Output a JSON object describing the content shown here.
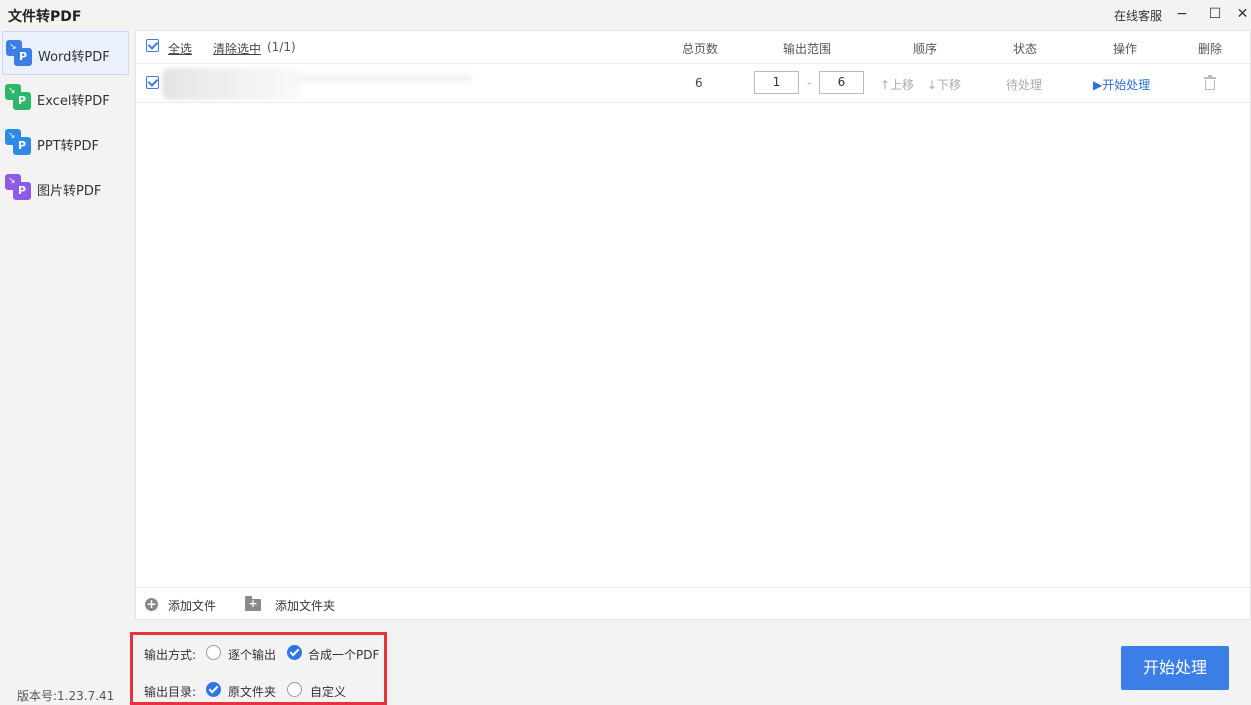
{
  "window": {
    "title": "文件转PDF",
    "service": "在线客服",
    "min_icon": "−",
    "max_icon": "☐",
    "close_icon": "✕"
  },
  "sidebar": {
    "items": [
      {
        "label": "Word转PDF",
        "color": "#3b7fe6",
        "active": true
      },
      {
        "label": "Excel转PDF",
        "color": "#2eb66a"
      },
      {
        "label": "PPT转PDF",
        "color": "#2e8ae6"
      },
      {
        "label": "图片转PDF",
        "color": "#8c5be8"
      }
    ]
  },
  "table": {
    "select_all": "全选",
    "clear_selection": "清除选中",
    "count": "(1/1)",
    "columns": {
      "pages": "总页数",
      "range": "输出范围",
      "order": "顺序",
      "status": "状态",
      "action": "操作",
      "delete": "删除"
    },
    "rows": [
      {
        "pages": "6",
        "range_from": "1",
        "range_sep": "-",
        "range_to": "6",
        "move_up": "↑上移",
        "move_down": "↓下移",
        "status": "待处理",
        "action": "▶开始处理"
      }
    ]
  },
  "bottom": {
    "add_file_icon": "+",
    "add_file": "添加文件",
    "add_folder_icon": "+",
    "add_folder": "添加文件夹"
  },
  "options": {
    "output_mode_label": "输出方式:",
    "output_mode_options": [
      "逐个输出",
      "合成一个PDF"
    ],
    "output_mode_selected": "合成一个PDF",
    "output_dir_label": "输出目录:",
    "output_dir_options": [
      "原文件夹",
      "自定义"
    ],
    "output_dir_selected": "原文件夹"
  },
  "footer": {
    "version": "版本号:1.23.7.41",
    "start_button": "开始处理"
  },
  "colors": {
    "accent": "#3a7ee6",
    "highlight_border": "#e8323b"
  }
}
